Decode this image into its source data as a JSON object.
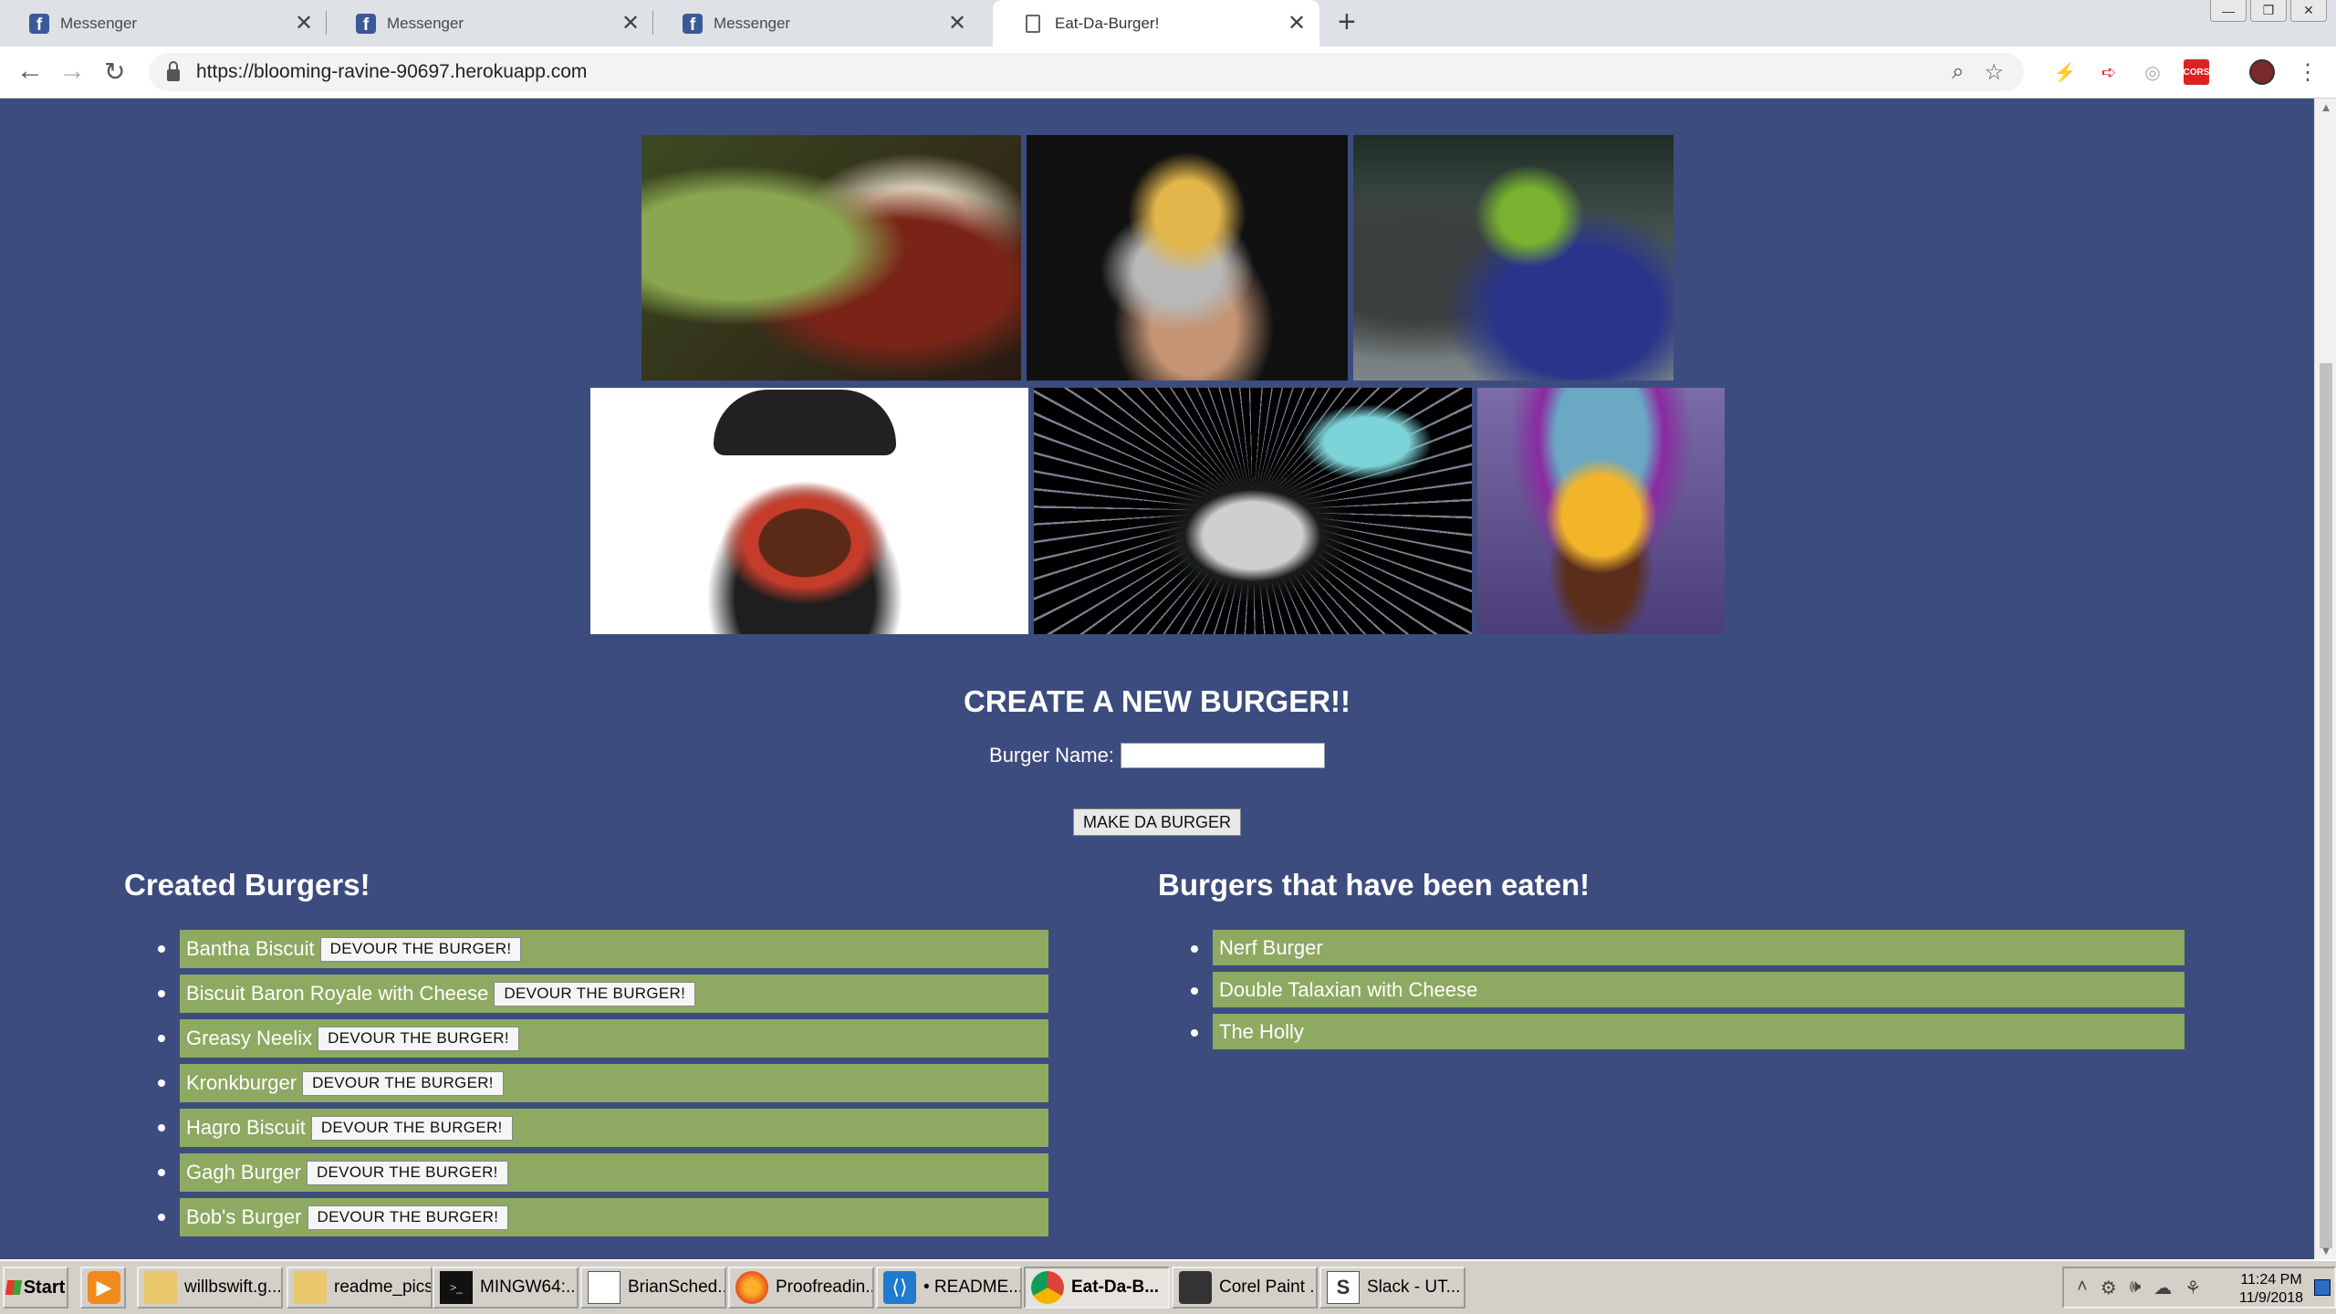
{
  "browser": {
    "tabs": [
      {
        "title": "Messenger",
        "icon": "facebook-icon",
        "active": false
      },
      {
        "title": "Messenger",
        "icon": "facebook-icon",
        "active": false
      },
      {
        "title": "Messenger",
        "icon": "facebook-icon",
        "active": false
      },
      {
        "title": "Eat-Da-Burger!",
        "icon": "document-icon",
        "active": true
      }
    ],
    "new_tab": "+",
    "url": "https://blooming-ravine-90697.herokuapp.com",
    "window_buttons": [
      "minimize",
      "restore",
      "close"
    ],
    "extensions": [
      "lightning-icon",
      "arrow-icon",
      "circle-icon",
      "cors-icon",
      "profile-avatar"
    ],
    "extension_badge": "CORS"
  },
  "page": {
    "images": [
      {
        "name": "burger-image-green"
      },
      {
        "name": "burger-image-plate"
      },
      {
        "name": "burger-image-blue"
      },
      {
        "name": "burger-image-black"
      },
      {
        "name": "burger-image-hyperspace"
      },
      {
        "name": "burger-image-galaxy"
      }
    ],
    "create_title": "CREATE A NEW BURGER!!",
    "form_label": "Burger Name:",
    "input_value": "",
    "submit_label": "MAKE DA BURGER",
    "created_title": "Created Burgers!",
    "eaten_title": "Burgers that have been eaten!",
    "devour_label": "DEVOUR THE BURGER!",
    "created_burgers": [
      "Bantha Biscuit",
      "Biscuit Baron Royale with Cheese",
      "Greasy Neelix",
      "Kronkburger",
      "Hagro Biscuit",
      "Gagh Burger",
      "Bob's Burger"
    ],
    "eaten_burgers": [
      "Nerf Burger",
      "Double Talaxian with Cheese",
      "The Holly"
    ],
    "colors": {
      "background": "#3d4c7e",
      "list_item": "#8ea962"
    }
  },
  "taskbar": {
    "start": "Start",
    "items": [
      {
        "label": "",
        "icon": "media-player-icon"
      },
      {
        "label": "willbswift.g...",
        "icon": "folder-icon"
      },
      {
        "label": "readme_pics",
        "icon": "folder-icon"
      },
      {
        "label": "MINGW64:...",
        "icon": "terminal-icon"
      },
      {
        "label": "BrianSched...",
        "icon": "word-document-icon"
      },
      {
        "label": "Proofreadin...",
        "icon": "firefox-icon"
      },
      {
        "label": "• README...",
        "icon": "vscode-icon"
      },
      {
        "label": "Eat-Da-B...",
        "icon": "chrome-icon",
        "active": true
      },
      {
        "label": "Corel Paint ...",
        "icon": "corel-icon"
      },
      {
        "label": "Slack - UT...",
        "icon": "slack-icon"
      }
    ],
    "time": "11:24 PM",
    "date": "11/9/2018"
  }
}
